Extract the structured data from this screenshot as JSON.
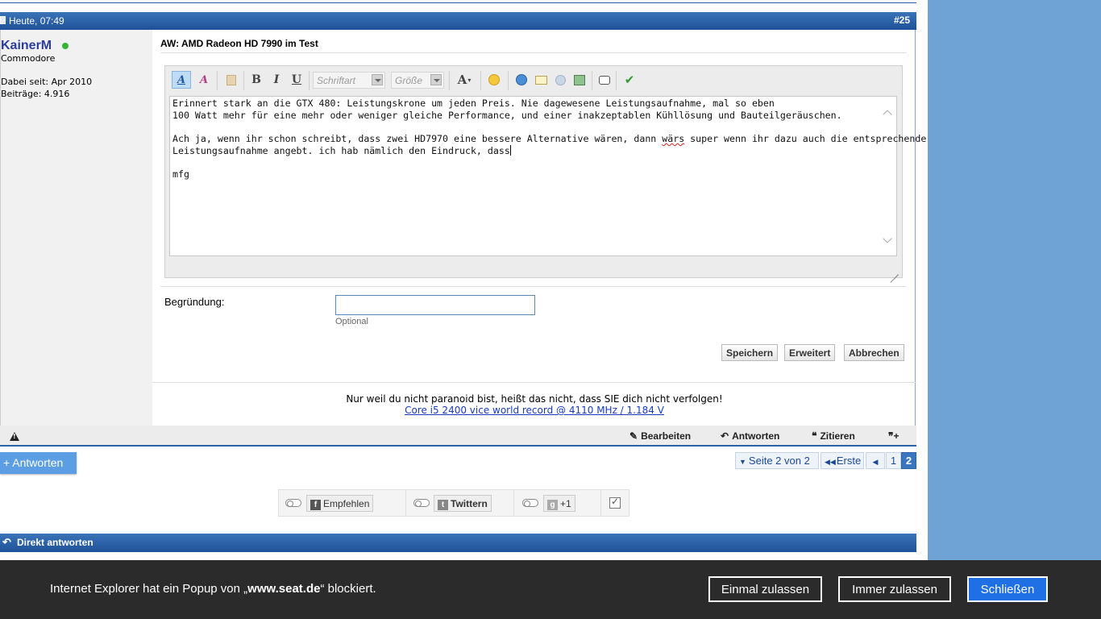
{
  "post": {
    "date": "Heute, 07:49",
    "number": "#25",
    "title": "AW: AMD Radeon HD 7990 im Test"
  },
  "user": {
    "name": "KainerM",
    "rank": "Commodore",
    "joined": "Dabei seit: Apr 2010",
    "posts": "Beiträge: 4.916"
  },
  "toolbar": {
    "font_placeholder": "Schriftart",
    "size_placeholder": "Größe"
  },
  "editor": {
    "line1": "Erinnert stark an die GTX 480: Leistungskrone um jeden Preis. Nie dagewesene Leistungsaufnahme, mal so eben",
    "line2": "100 Watt mehr für eine mehr oder weniger gleiche Performance, und einer inakzeptablen Kühllösung und Bauteilgeräuschen.",
    "line3_a": "Ach ja, wenn ihr schon schreibt, dass zwei HD7970 eine bessere Alternative wären, dann ",
    "line3_misspelled": "wärs",
    "line3_b": " super wenn ihr dazu auch die entsprechende",
    "line4": "Leistungsaufnahme angebt. ich hab nämlich den Eindruck, dass",
    "line5": "mfg"
  },
  "reason": {
    "label": "Begründung:",
    "value": "",
    "hint": "Optional"
  },
  "buttons": {
    "save": "Speichern",
    "advanced": "Erweitert",
    "cancel": "Abbrechen"
  },
  "signature": {
    "line1": "Nur weil du nicht paranoid bist, heißt das nicht, dass SIE dich nicht verfolgen!",
    "link": "Core i5 2400 vice world record @ 4110 MHz / 1.184 V"
  },
  "footer": {
    "edit": "Bearbeiten",
    "reply": "Antworten",
    "quote": "Zitieren"
  },
  "below": {
    "reply_button": "+ Antworten",
    "page_of": "Seite 2 von 2",
    "first": "Erste",
    "page1": "1",
    "page2": "2"
  },
  "social": {
    "recommend": "Empfehlen",
    "twitter": "Twittern",
    "gplus": "+1"
  },
  "direct_reply": "Direkt antworten",
  "iebar": {
    "msg_prefix": "Internet Explorer hat ein Popup von „",
    "site": "www.seat.de",
    "msg_suffix": "“ blockiert.",
    "allow_once": "Einmal zulassen",
    "allow_always": "Immer zulassen",
    "close": "Schließen"
  },
  "colors": {
    "header_blue": "#1e5199",
    "username": "#2c3e9c",
    "online": "#35b535",
    "ie_primary": "#1f6fe5"
  }
}
